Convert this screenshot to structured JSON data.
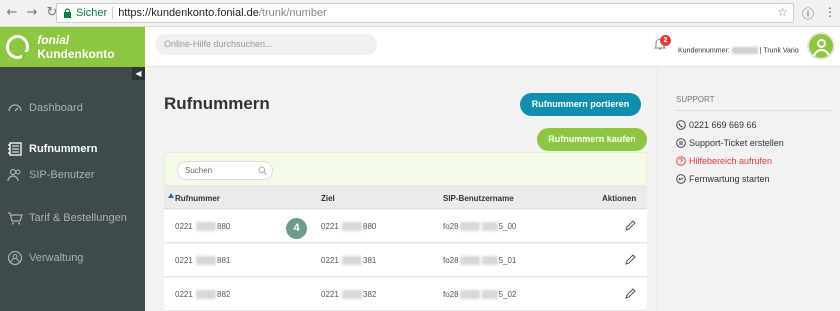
{
  "browser": {
    "secure_label": "Sicher",
    "url_host": "https://kundenkonto.fonial.de",
    "url_path": "/trunk/number"
  },
  "brand": {
    "name_italic": "fonial",
    "name_rest": "Kundenkonto",
    "color": "#8dc63f"
  },
  "topbar": {
    "search_placeholder": "Online-Hilfe durchsuchen...",
    "notification_count": "2",
    "customer_label": "Kundennummer:",
    "customer_suffix": "| Trunk Vario"
  },
  "sidebar": {
    "items": [
      {
        "label": "Dashboard",
        "icon": "dashboard-icon"
      },
      {
        "label": "Rufnummern",
        "icon": "phonebook-icon",
        "active": true
      },
      {
        "label": "SIP-Benutzer",
        "icon": "users-icon"
      },
      {
        "label": "Tarif & Bestellungen",
        "icon": "cart-icon"
      },
      {
        "label": "Verwaltung",
        "icon": "user-circle-icon"
      }
    ]
  },
  "main": {
    "title": "Rufnummern",
    "port_button": "Rufnummern portieren",
    "buy_button": "Rufnummern kaufen",
    "search_placeholder": "Suchen",
    "columns": {
      "number": "Rufnummer",
      "target": "Ziel",
      "sip_user": "SIP-Benutzername",
      "actions": "Aktionen"
    },
    "rows": [
      {
        "num_a": "0221",
        "num_b": "880",
        "target_a": "0221",
        "target_b": "880",
        "sip_a": "fo28",
        "sip_b": "5_00"
      },
      {
        "num_a": "0221",
        "num_b": "881",
        "target_a": "0221",
        "target_b": "381",
        "sip_a": "fo28",
        "sip_b": "5_01"
      },
      {
        "num_a": "0221",
        "num_b": "882",
        "target_a": "0221",
        "target_b": "382",
        "sip_a": "fo28",
        "sip_b": "5_02"
      }
    ],
    "step_marker": "4"
  },
  "support": {
    "title": "SUPPORT",
    "items": [
      {
        "label": "0221 669 669 66",
        "icon": "phone-icon"
      },
      {
        "label": "Support-Ticket erstellen",
        "icon": "ticket-icon"
      },
      {
        "label": "Hilfebereich aufrufen",
        "icon": "help-icon",
        "color": "#e53935"
      },
      {
        "label": "Fernwartung starten",
        "icon": "remote-icon"
      }
    ]
  }
}
